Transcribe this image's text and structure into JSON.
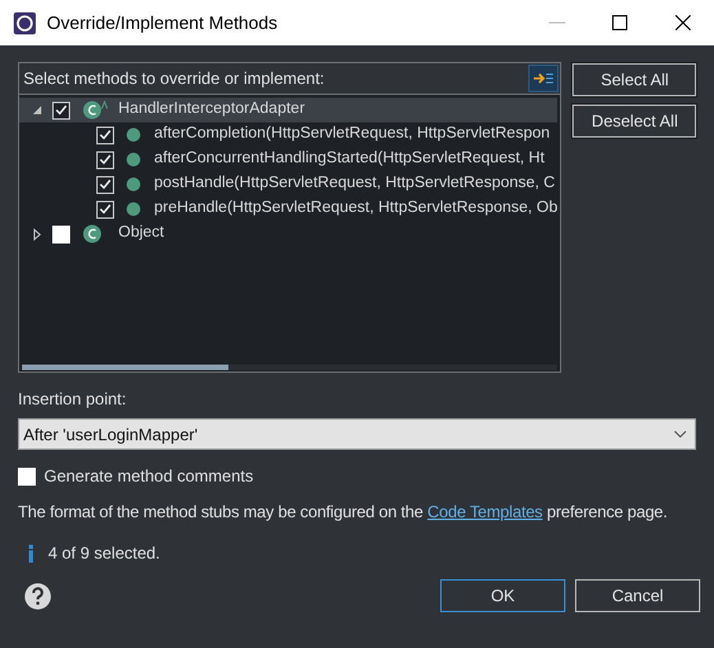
{
  "window": {
    "title": "Override/Implement Methods"
  },
  "tree_header": "Select methods to override or implement:",
  "tree": [
    {
      "kind": "class",
      "label": "HandlerInterceptorAdapter",
      "checked": true,
      "expanded": true,
      "selected": true,
      "children": [
        {
          "kind": "method",
          "label": "afterCompletion(HttpServletRequest, HttpServletRespon",
          "checked": true,
          "selected": false
        },
        {
          "kind": "method",
          "label": "afterConcurrentHandlingStarted(HttpServletRequest, Ht",
          "checked": true,
          "selected": false
        },
        {
          "kind": "method",
          "label": "postHandle(HttpServletRequest, HttpServletResponse, C",
          "checked": true,
          "selected": false
        },
        {
          "kind": "method",
          "label": "preHandle(HttpServletRequest, HttpServletResponse, Ob",
          "checked": true,
          "selected": false
        }
      ]
    },
    {
      "kind": "class",
      "label": "Object",
      "checked": false,
      "expanded": false,
      "selected": false
    }
  ],
  "side_buttons": [
    "Select All",
    "Deselect All"
  ],
  "insertion_label": "Insertion point:",
  "insertion_value": "After 'userLoginMapper'",
  "generate_comments": {
    "label": "Generate method comments",
    "checked": false
  },
  "info_text": {
    "before": "The format of the method stubs may be configured on the",
    "link": "Code Templates",
    "after": "preference page."
  },
  "status": "4 of 9 selected.",
  "buttons": [
    {
      "label": "OK",
      "default": true
    },
    {
      "label": "Cancel",
      "default": false
    }
  ]
}
